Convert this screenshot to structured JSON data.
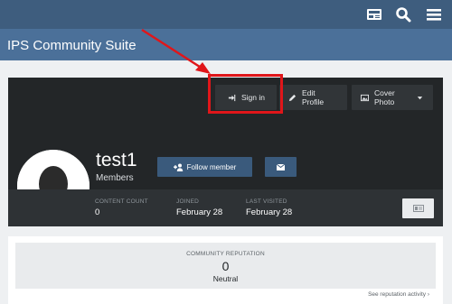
{
  "header": {
    "site_title": "IPS Community Suite",
    "icons": [
      "member-card-icon",
      "search-icon",
      "menu-icon"
    ]
  },
  "profile_actions": {
    "sign_in": "Sign in",
    "edit_profile": "Edit Profile",
    "cover_photo": "Cover Photo"
  },
  "member": {
    "username": "test1",
    "group": "Members",
    "follow_label": "Follow member"
  },
  "stats": [
    {
      "label": "CONTENT COUNT",
      "value": "0"
    },
    {
      "label": "JOINED",
      "value": "February 28"
    },
    {
      "label": "LAST VISITED",
      "value": "February 28"
    }
  ],
  "reputation": {
    "title": "COMMUNITY REPUTATION",
    "value": "0",
    "status": "Neutral",
    "link": "See reputation activity"
  },
  "colors": {
    "nav_bar": "#3e5d7e",
    "header_bar": "#4b7099",
    "profile_bg": "#232628",
    "highlight": "#e0161a",
    "button_blue": "#3a5a7c"
  }
}
